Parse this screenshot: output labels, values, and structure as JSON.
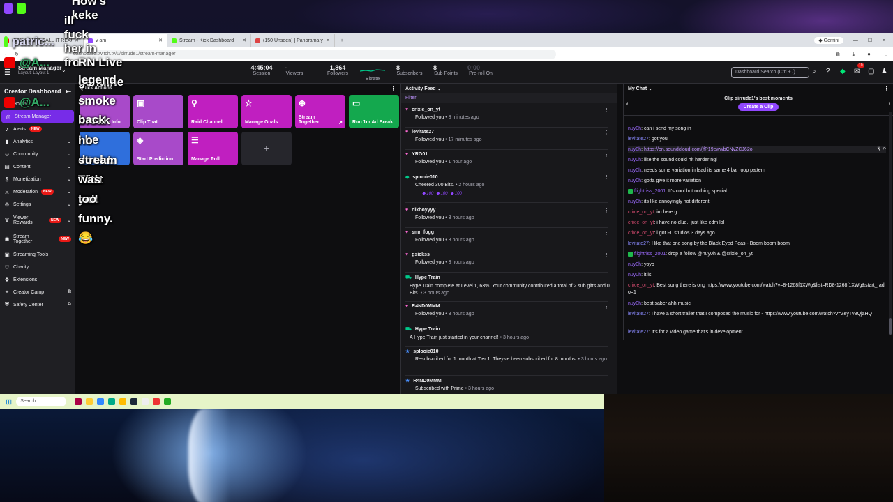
{
  "overlay": {
    "lines": [
      {
        "name": "",
        "msg": "How's keke"
      },
      {
        "name": "patric...",
        "msg": "ill fuck her in front"
      },
      {
        "name": "@A...",
        "msg": ""
      },
      {
        "name": "@A...",
        "msg": ""
      }
    ],
    "text1": "RN Live genuine",
    "text2": "legend",
    "text3": "smoke break I be",
    "text4": "back",
    "text5": "no doubt. That last",
    "text6": "stream with yall",
    "text7": "was too funny. 😂"
  },
  "browser": {
    "tabs": [
      {
        "label": "(373) I CANT CALL IT REACTS",
        "color": "#ff0000"
      },
      {
        "label": "v am",
        "color": "#9147ff"
      },
      {
        "label": "Stream - Kick Dashboard",
        "color": "#53fc18"
      },
      {
        "label": "(150 Unseen) | Panorama your...",
        "color": "#d44"
      }
    ],
    "new_tab": "+",
    "url": "dashboard.twitch.tv/u/sirrude1/stream-manager",
    "gemini_label": "Gemini",
    "win_controls": [
      "—",
      "☐",
      "✕"
    ]
  },
  "topbar": {
    "stream_manager": "Stream Manager",
    "layout": "Layout: Layout 1",
    "stats": [
      {
        "value": "4:45:04",
        "label": "Session"
      },
      {
        "value": "-",
        "label": "Viewers"
      },
      {
        "value": "1,864",
        "label": "Followers"
      },
      {
        "value": "",
        "label": "Bitrate"
      },
      {
        "value": "8",
        "label": "Subscribers"
      },
      {
        "value": "8",
        "label": "Sub Points"
      },
      {
        "value": "0:00",
        "label": "Pre-roll On"
      }
    ],
    "search_placeholder": "Dashboard Search (Ctrl + /)",
    "notif_count": "10"
  },
  "sidebar": {
    "title": "Creator Dashboard",
    "items": [
      {
        "label": "Home",
        "icon": "⌂"
      },
      {
        "label": "Stream Manager",
        "icon": "((·))",
        "active": true
      },
      {
        "label": "Alerts",
        "icon": "🔔",
        "badge": "NEW"
      },
      {
        "label": "Analytics",
        "icon": "▮"
      },
      {
        "label": "Community",
        "icon": "☺"
      },
      {
        "label": "Content",
        "icon": "▤"
      },
      {
        "label": "Monetization",
        "icon": "$"
      },
      {
        "label": "Moderation",
        "icon": "⚔",
        "badge": "NEW"
      },
      {
        "label": "Settings",
        "icon": "⚙"
      },
      {
        "label": "Viewer Rewards",
        "icon": "♛",
        "badge": "NEW"
      },
      {
        "label": "Stream Together",
        "icon": "◉",
        "badge": "NEW"
      },
      {
        "label": "Streaming Tools",
        "icon": "▣"
      },
      {
        "label": "Charity",
        "icon": "♡"
      },
      {
        "label": "Extensions",
        "icon": "❖"
      },
      {
        "label": "Creator Camp",
        "icon": "⌖"
      },
      {
        "label": "Safety Center",
        "icon": "⛨"
      }
    ]
  },
  "quick_actions": {
    "title": "Quick Actions",
    "tiles": [
      {
        "label": "Edit Stream Info",
        "icon": "✎",
        "color": "#a84ac9"
      },
      {
        "label": "Clip That",
        "icon": "▣",
        "color": "#a84ac9"
      },
      {
        "label": "Raid Channel",
        "icon": "⚲",
        "color": "#c01fc0"
      },
      {
        "label": "Manage Goals",
        "icon": "☆",
        "color": "#c01fc0"
      },
      {
        "label": "Stream Together",
        "icon": "⊕",
        "color": "#c01fc0"
      },
      {
        "label": "Run 1m Ad Break",
        "icon": "▭",
        "color": "#14a84e"
      },
      {
        "label": "Sub Only",
        "icon": "★",
        "color": "#2f6fdc"
      },
      {
        "label": "Start Prediction",
        "icon": "◈",
        "color": "#a84ac9"
      },
      {
        "label": "Manage Poll",
        "icon": "☰",
        "color": "#c01fc0"
      }
    ],
    "add_label": "+"
  },
  "activity": {
    "title": "Activity Feed",
    "filter": "Filter",
    "items": [
      {
        "name": "crixie_on_yt",
        "desc": "Followed you",
        "time": "8 minutes ago"
      },
      {
        "name": "levitate27",
        "desc": "Followed you",
        "time": "17 minutes ago"
      },
      {
        "name": "YRG01",
        "desc": "Followed you",
        "time": "1 hour ago"
      },
      {
        "name": "splooie010",
        "desc": "Cheered 300 Bits.",
        "time": "2 hours ago"
      },
      {
        "name": "nikboyyyy",
        "desc": "Followed you",
        "time": "3 hours ago"
      },
      {
        "name": "smr_fogg",
        "desc": "Followed you",
        "time": "3 hours ago"
      },
      {
        "name": "gsickss",
        "desc": "Followed you",
        "time": "3 hours ago"
      },
      {
        "name": "Hype Train",
        "desc": "Hype Train complete at Level 1, 63%! Your community contributed a total of 2 sub gifts and 0 Bits.",
        "time": "3 hours ago"
      },
      {
        "name": "R4ND0MMM",
        "desc": "Followed you",
        "time": "3 hours ago"
      },
      {
        "name": "Hype Train",
        "desc": "A Hype Train just started in your channel!",
        "time": "3 hours ago"
      },
      {
        "name": "splooie010",
        "desc": "Resubscribed for 1 month at Tier 1. They've been subscribed for 8 months!",
        "time": "3 hours ago"
      },
      {
        "name": "R4ND0MMM",
        "desc": "Subscribed with Prime",
        "time": "3 hours ago"
      }
    ],
    "bits": [
      "100",
      "100",
      "100"
    ]
  },
  "chat": {
    "title": "My Chat",
    "clip_title": "Clip sirrude1's best moments",
    "clip_button": "Create a Clip",
    "messages": [
      {
        "user": "nuy0h",
        "text": "can i send my song in"
      },
      {
        "user": "levitate27",
        "text": "got you"
      },
      {
        "user": "nuy0h",
        "text": "https://on.soundcloud.com/jfP19ewwbCNvZCJ62o"
      },
      {
        "user": "nuy0h",
        "text": "like the sound could hit harder ngl"
      },
      {
        "user": "nuy0h",
        "text": "needs some variation in lead its same 4 bar loop pattern"
      },
      {
        "user": "nuy0h",
        "text": "gotta give it more variation"
      },
      {
        "user": "flightriss_2001",
        "text": "It's cool but nothing special"
      },
      {
        "user": "nuy0h",
        "text": "its like annoyingly not different"
      },
      {
        "user": "crixie_on_yt",
        "text": "im here g"
      },
      {
        "user": "crixie_on_yt",
        "text": "i have no clue.. just like edm lol"
      },
      {
        "user": "crixie_on_yt",
        "text": "i got FL studios 3 days ago"
      },
      {
        "user": "levitate27",
        "text": "I like that one song by the Black Eyed Peas - Boom boom boom"
      },
      {
        "user": "flightriss_2001",
        "text": "drop a follow @nuy0h & @crixie_on_yt"
      },
      {
        "user": "nuy0h",
        "text": "yoyo"
      },
      {
        "user": "nuy0h",
        "text": "it is"
      },
      {
        "user": "crixie_on_yt",
        "text": "Best song there is ong https://www.youtube.com/watch?v=8-1268f1XWg&list=RD8-1268f1XWg&start_radio=1"
      },
      {
        "user": "nuy0h",
        "text": "beat saber ahh music"
      },
      {
        "user": "levitate27",
        "text": "I have a short trailer that I composed the music for - https://www.youtube.com/watch?v=ZeyTv8QjaHQ"
      },
      {
        "user": "levitate27",
        "text": "It's for a video game that's in development"
      }
    ]
  },
  "taskbar": {
    "search_placeholder": "Search"
  }
}
